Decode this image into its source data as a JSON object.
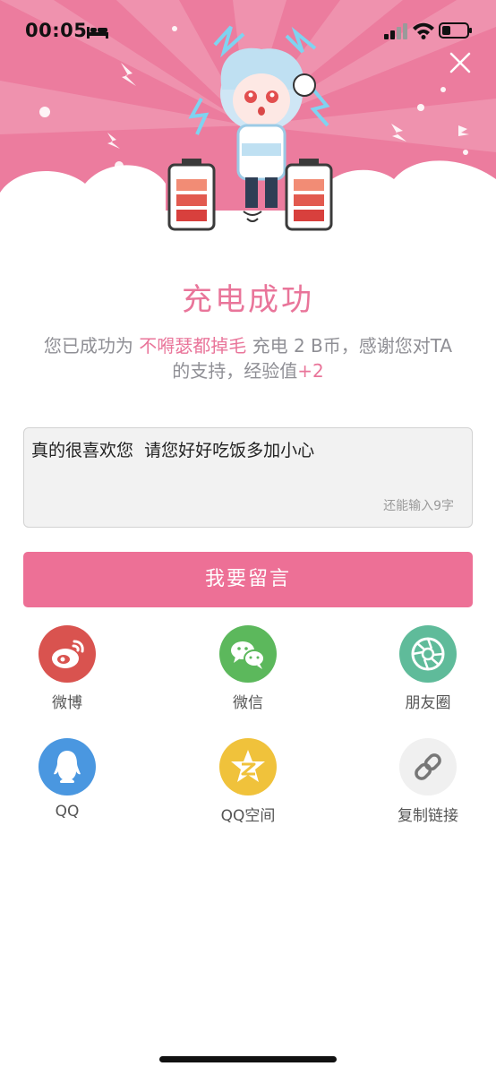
{
  "status_bar": {
    "time": "00:05"
  },
  "colors": {
    "brand_pink": "#ed7096",
    "weibo": "#d9534f",
    "wechat": "#5cb85c",
    "moments": "#5fbb9a",
    "qq": "#4a97e0",
    "qzone": "#f0c23b",
    "link": "#f0f0f0"
  },
  "main": {
    "title": "充电成功",
    "desc_prefix": "您已成功为",
    "recipient": "不嘚瑟都掉毛",
    "desc_middle": "充电 2 B币，感谢您对TA的支持，经验值",
    "exp_bonus": "+2"
  },
  "message": {
    "text": "真的很喜欢您  请您好好吃饭多加小心",
    "remaining": "还能输入9字"
  },
  "submit_label": "我要留言",
  "share": [
    {
      "label": "微博",
      "icon": "weibo-icon"
    },
    {
      "label": "微信",
      "icon": "wechat-icon"
    },
    {
      "label": "朋友圈",
      "icon": "moments-icon"
    },
    {
      "label": "QQ",
      "icon": "qq-icon"
    },
    {
      "label": "QQ空间",
      "icon": "qzone-icon"
    },
    {
      "label": "复制链接",
      "icon": "link-icon"
    }
  ]
}
